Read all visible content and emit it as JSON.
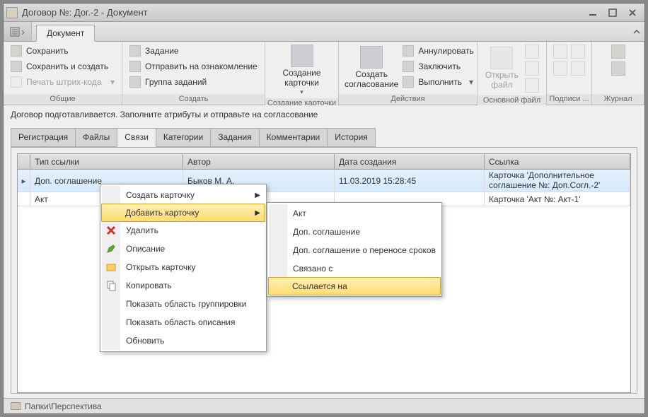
{
  "window": {
    "title": "Договор №: Дог.-2 - Документ"
  },
  "ribbonTab": "Документ",
  "ribbon": {
    "g1": {
      "title": "Общие",
      "save": "Сохранить",
      "saveCreate": "Сохранить и создать",
      "barcode": "Печать штрих-кода"
    },
    "g2": {
      "title": "Создать",
      "task": "Задание",
      "sendReview": "Отправить на ознакомление",
      "taskGroup": "Группа заданий"
    },
    "g3": {
      "title": "Создание карточки",
      "createCard1": "Создание карточки",
      "createCard2": "Создание карточки"
    },
    "g4": {
      "title": "Действия",
      "createApproval": "Создать согласование",
      "cancel": "Аннулировать",
      "sign": "Заключить",
      "exec": "Выполнить"
    },
    "g5": {
      "title": "Основной файл",
      "openFile": "Открыть файл"
    },
    "g6": {
      "title": "Подписи ..."
    },
    "g7": {
      "title": "Журнал"
    }
  },
  "info": "Договор подготавливается. Заполните атрибуты и отправьте на согласование",
  "tabs": [
    "Регистрация",
    "Файлы",
    "Связи",
    "Категории",
    "Задания",
    "Комментарии",
    "История"
  ],
  "activeTab": 2,
  "grid": {
    "headers": [
      "Тип ссылки",
      "Автор",
      "Дата создания",
      "Ссылка"
    ],
    "rows": [
      {
        "type": "Доп. соглашение",
        "author": "Быков М. А.",
        "date": "11.03.2019 15:28:45",
        "link": "Карточка 'Дополнительное соглашение №: Доп.Согл.-2'"
      },
      {
        "type": "Акт",
        "author": "",
        "date": "",
        "link": "Карточка 'Акт №: Акт-1'"
      }
    ]
  },
  "ctx1": {
    "createCard": "Создать карточку",
    "addCard": "Добавить карточку",
    "delete": "Удалить",
    "desc": "Описание",
    "openCard": "Открыть карточку",
    "copy": "Копировать",
    "showGroup": "Показать область группировки",
    "showDesc": "Показать область описания",
    "refresh": "Обновить"
  },
  "ctx2": {
    "act": "Акт",
    "addendum": "Доп. соглашение",
    "addendumDates": "Доп. соглашение о переносе сроков",
    "relatedTo": "Связано с",
    "refersTo": "Ссылается на"
  },
  "footer": "Папки\\Перспектива"
}
